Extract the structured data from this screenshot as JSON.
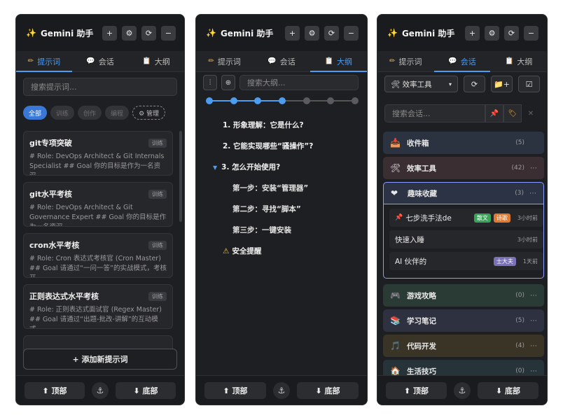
{
  "app_title": "Gemini 助手",
  "header_buttons": [
    "+",
    "⚙",
    "⟳",
    "−"
  ],
  "tabs": [
    {
      "label": "提示词",
      "icon": "pencil-icon"
    },
    {
      "label": "会话",
      "icon": "chat-icon"
    },
    {
      "label": "大纲",
      "icon": "clipboard-icon"
    }
  ],
  "footer": {
    "top_label": "⬆ 顶部",
    "bottom_label": "⬇ 底部",
    "anchor": "⚓"
  },
  "prompts_panel": {
    "search_placeholder": "搜索提示词...",
    "filters": [
      "全部",
      "训练",
      "创作",
      "编程"
    ],
    "manage_label": "⚙ 管理",
    "cards": [
      {
        "title": "git专项突破",
        "tag": "训练",
        "desc": "# Role: DevOps Architect & Git Internals Specialist ## Goal 你的目标是作为一名资深..."
      },
      {
        "title": "git水平考核",
        "tag": "训练",
        "desc": "# Role: DevOps Architect & Git Governance Expert ## Goal 你的目标是作为一名资深..."
      },
      {
        "title": "cron水平考核",
        "tag": "训练",
        "desc": "# Role: Cron 表达式考核官 (Cron Master) ## Goal 请通过“一问一答”的实战模式，考核开..."
      },
      {
        "title": "正则表达式水平考核",
        "tag": "训练",
        "desc": "# Role: 正则表达式面试官 (Regex Master) ## Goal 请通过“出题-批改-讲解”的互动模式，..."
      },
      {
        "title": "",
        "tag": "",
        "desc": ""
      }
    ],
    "add_label": "+ 添加新提示词"
  },
  "outline_panel": {
    "search_placeholder": "搜索大纲...",
    "tool_buttons": [
      "⫶",
      "⊕"
    ],
    "level_count": 7,
    "active_levels": 4,
    "items": [
      {
        "text": "1. 形象理解：它是什么?",
        "level": 1
      },
      {
        "text": "2. 它能实现哪些“骚操作”?",
        "level": 1
      },
      {
        "text": "3. 怎么开始使用?",
        "level": 1,
        "expanded": true
      },
      {
        "text": "第一步：安装“管理器”",
        "level": 2
      },
      {
        "text": "第二步：寻找“脚本”",
        "level": 2
      },
      {
        "text": "第三步：一键安装",
        "level": 2
      },
      {
        "text": "安全提醒",
        "level": 1,
        "warn": true
      }
    ]
  },
  "sessions_panel": {
    "folder_select": "🛠 效率工具",
    "tool_buttons": [
      "⟳",
      "📁+",
      "☑"
    ],
    "search_placeholder": "搜索会话...",
    "groups_before": [
      {
        "name": "收件箱",
        "count": "(5)",
        "icon": "📥",
        "cls": "g-inbox",
        "more": ""
      },
      {
        "name": "效率工具",
        "count": "(42)",
        "icon": "🛠",
        "cls": "g-tools",
        "more": "⋯"
      }
    ],
    "fav_group": {
      "name": "趣味收藏",
      "count": "(3)",
      "icon": "❤",
      "more": "⋯"
    },
    "fav_sessions": [
      {
        "name": "七步洗手法de",
        "pinned": true,
        "badges": [
          {
            "text": "散文",
            "color": "green"
          },
          {
            "text": "诗歌",
            "color": "orange"
          }
        ],
        "time": "3小时前"
      },
      {
        "name": "快速入睡",
        "pinned": false,
        "badges": [],
        "time": "3小时前"
      },
      {
        "name": "AI 伙伴的",
        "pinned": false,
        "badges": [
          {
            "text": "士大夫",
            "color": "purple"
          }
        ],
        "time": "1天前"
      }
    ],
    "groups_after": [
      {
        "name": "游戏攻略",
        "count": "(0)",
        "icon": "🎮",
        "cls": "g-game",
        "more": "⋯"
      },
      {
        "name": "学习笔记",
        "count": "(5)",
        "icon": "📚",
        "cls": "g-study",
        "more": "⋯"
      },
      {
        "name": "代码开发",
        "count": "(4)",
        "icon": "🎵",
        "cls": "g-code",
        "more": "⋯"
      },
      {
        "name": "生活技巧",
        "count": "(0)",
        "icon": "🏠",
        "cls": "g-life",
        "more": "⋯"
      }
    ]
  }
}
